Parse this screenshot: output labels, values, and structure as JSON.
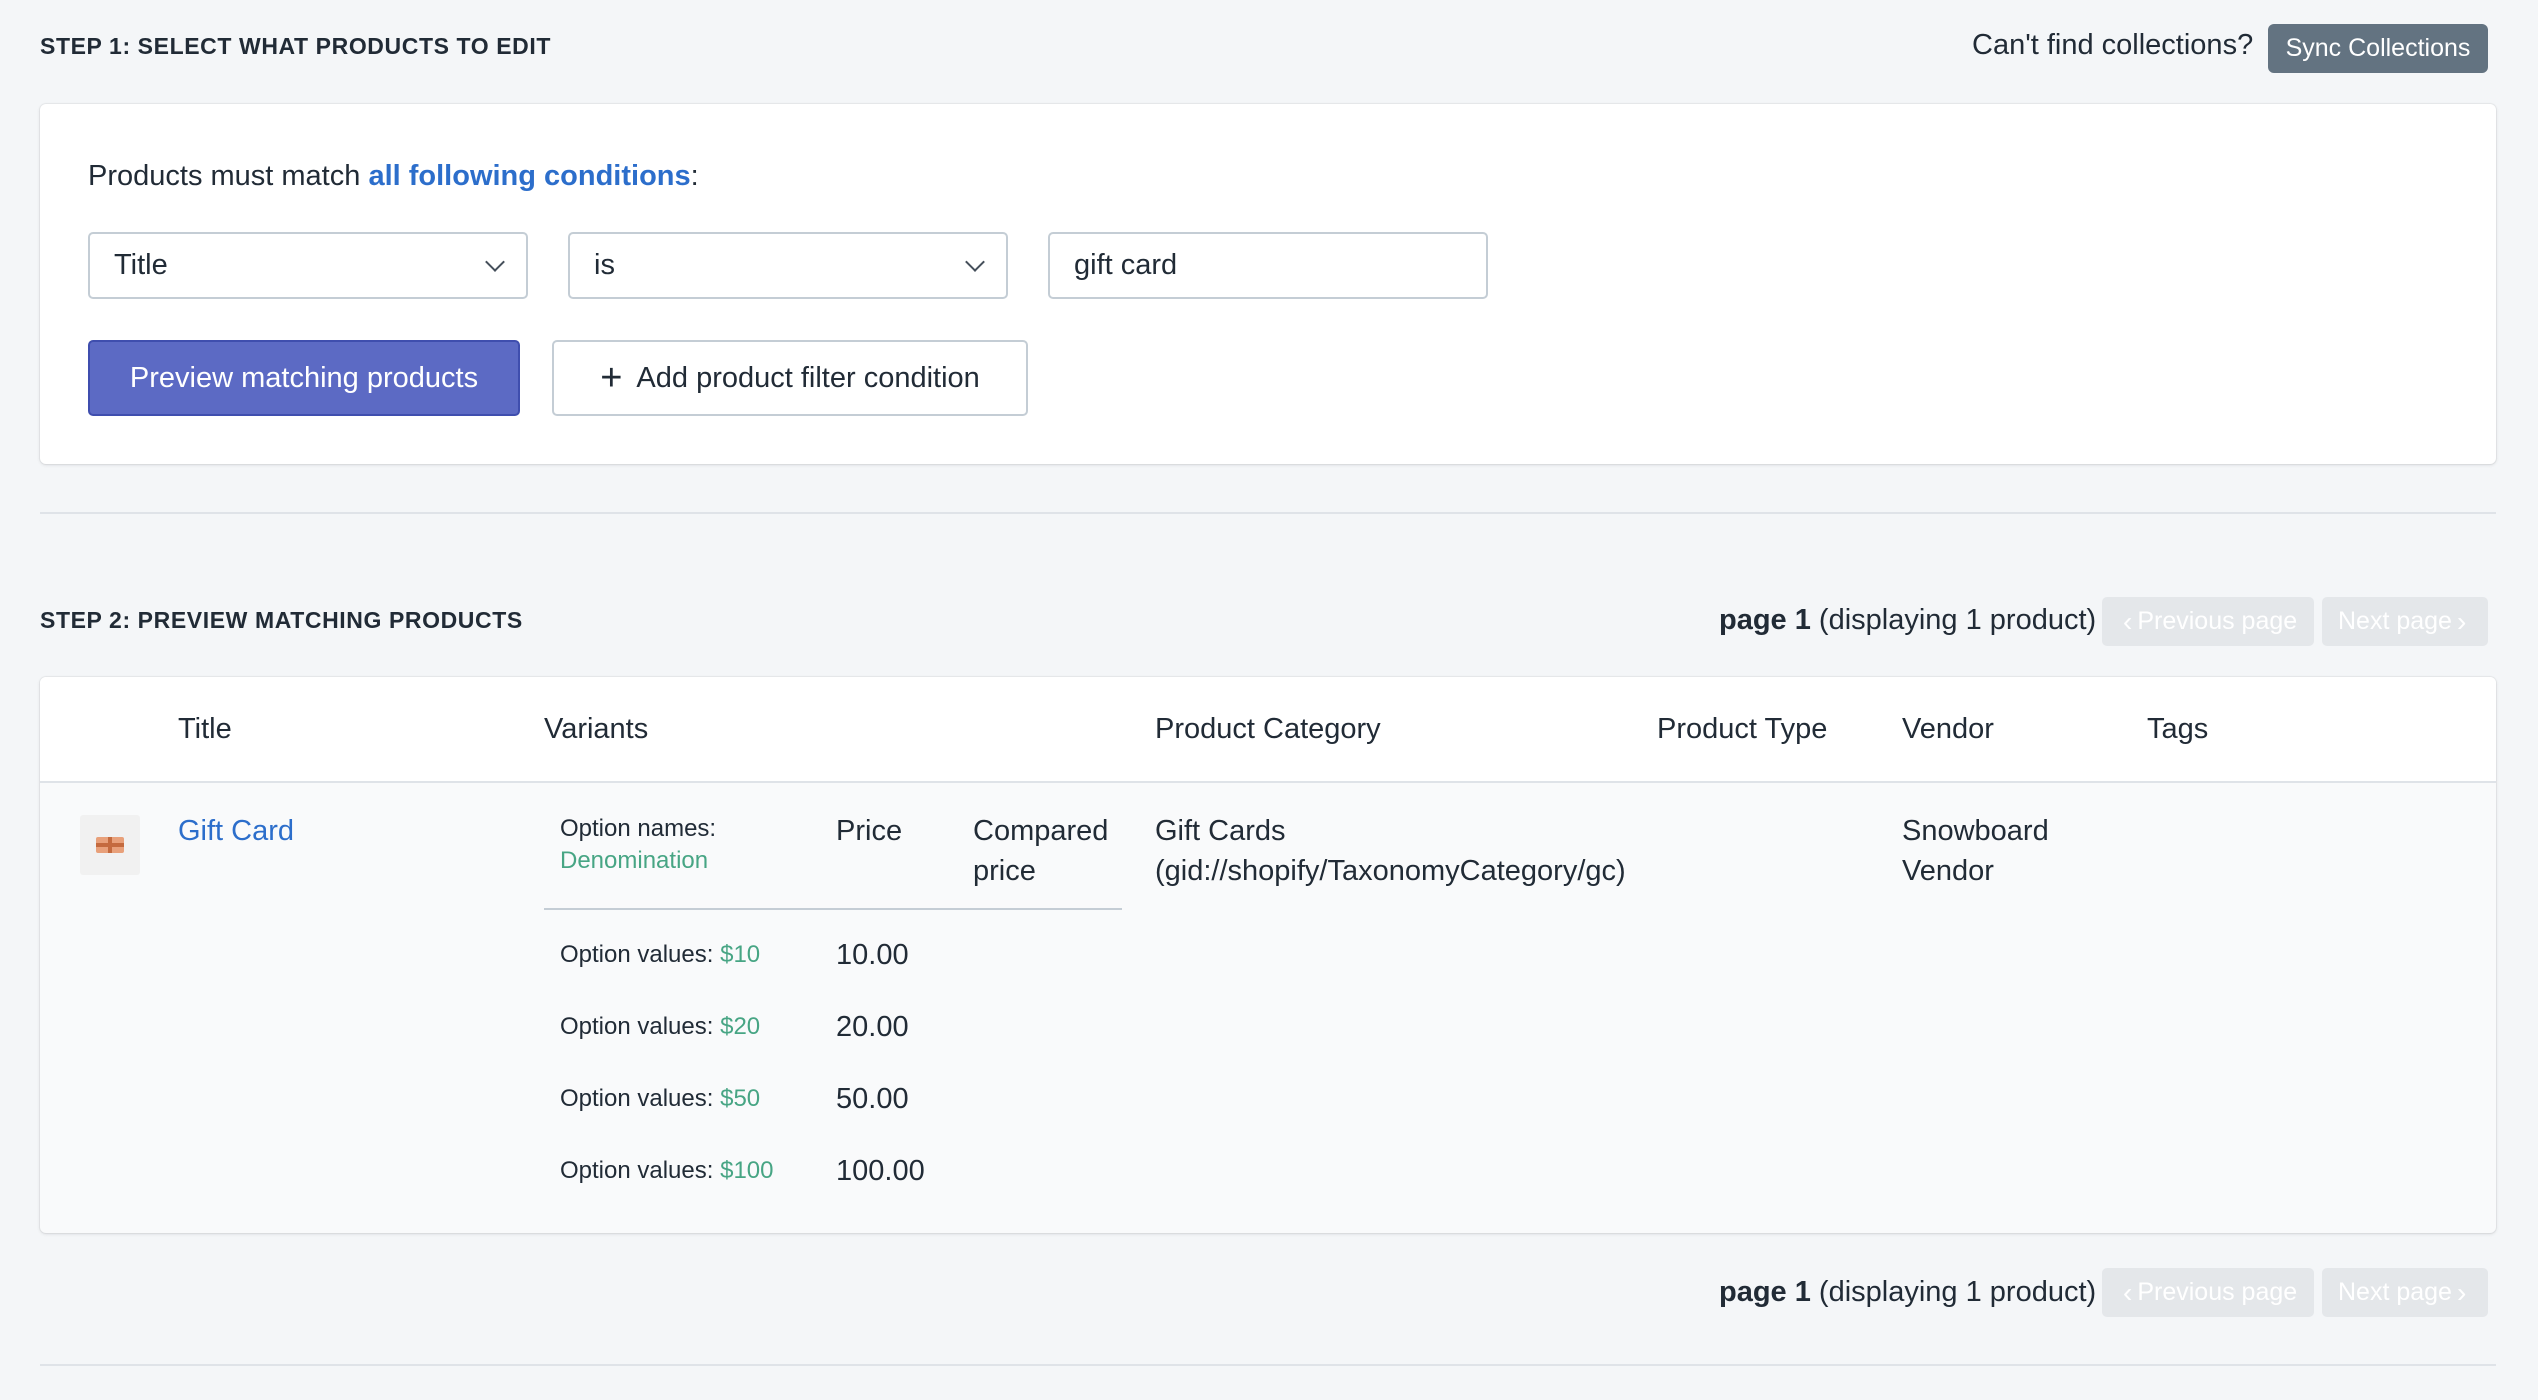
{
  "step1": {
    "title": "STEP 1: SELECT WHAT PRODUCTS TO EDIT",
    "cant_find": "Can't find collections?",
    "sync_button": "Sync Collections"
  },
  "filter": {
    "match_prefix": "Products must match ",
    "match_link": "all following conditions",
    "match_suffix": ":",
    "field_select": "Title",
    "operator_select": "is",
    "value_input": "gift card",
    "preview_button": "Preview matching products",
    "add_condition_button": "Add product filter condition"
  },
  "step2": {
    "title": "STEP 2: PREVIEW MATCHING PRODUCTS",
    "page_label": "page 1",
    "page_detail": " (displaying 1 product)",
    "prev_label": "Previous page",
    "next_label": "Next page"
  },
  "table": {
    "headers": {
      "title": "Title",
      "variants": "Variants",
      "category": "Product Category",
      "type": "Product Type",
      "vendor": "Vendor",
      "tags": "Tags"
    },
    "row": {
      "title": "Gift Card",
      "category_line1": "Gift Cards",
      "category_line2": "(gid://shopify/TaxonomyCategory/gc)",
      "type": "",
      "vendor_line1": "Snowboard",
      "vendor_line2": "Vendor",
      "tags": "",
      "variants": {
        "option_names_label": "Option names:",
        "option_name": "Denomination",
        "price_header": "Price",
        "compared_header_line1": "Compared",
        "compared_header_line2": "price",
        "option_values_label": "Option values: ",
        "rows": [
          {
            "value": "$10",
            "price": "10.00",
            "compared": ""
          },
          {
            "value": "$20",
            "price": "20.00",
            "compared": ""
          },
          {
            "value": "$50",
            "price": "50.00",
            "compared": ""
          },
          {
            "value": "$100",
            "price": "100.00",
            "compared": ""
          }
        ]
      }
    }
  },
  "icons": [
    "chevron-down-icon",
    "plus-icon",
    "chevron-left-icon",
    "chevron-right-icon",
    "gift-card-icon"
  ]
}
